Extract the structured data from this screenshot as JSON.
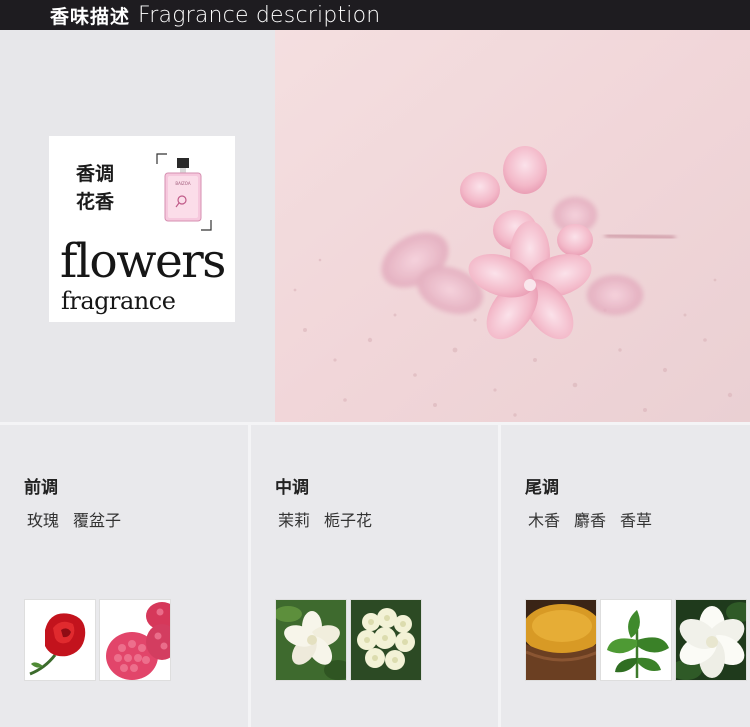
{
  "header": {
    "title_cn": "香味描述",
    "title_en": "Fragrance description"
  },
  "scent_card": {
    "label_line1": "香调",
    "label_line2": "花香",
    "big_word": "flowers",
    "small_word": "fragrance"
  },
  "notes": [
    {
      "title": "前调",
      "items": [
        "玫瑰",
        "覆盆子"
      ],
      "thumbs": [
        "rose-icon",
        "raspberry-icon"
      ]
    },
    {
      "title": "中调",
      "items": [
        "茉莉",
        "栀子花"
      ],
      "thumbs": [
        "jasmine-icon",
        "gardenia-cluster-icon"
      ]
    },
    {
      "title": "尾调",
      "items": [
        "木香",
        "麝香",
        "香草"
      ],
      "thumbs": [
        "spice-bowl-icon",
        "basil-leaf-icon",
        "white-gardenia-icon"
      ]
    }
  ],
  "colors": {
    "header_bg": "#1e1c20",
    "page_bg": "#e9e9ec",
    "hero_pink": "#f2d9dc",
    "petal_pink": "#f0a9bd"
  }
}
